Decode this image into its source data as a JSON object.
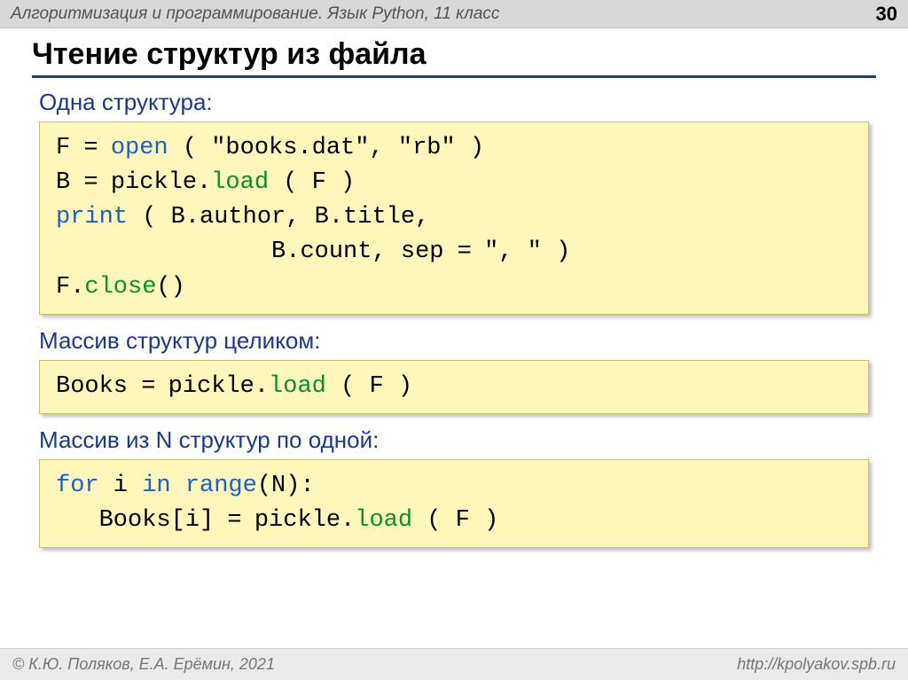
{
  "header": {
    "title": "Алгоритмизация и программирование. Язык Python, 11 класс",
    "page": "30"
  },
  "title": "Чтение структур из файла",
  "section1": {
    "label": "Одна структура:"
  },
  "code1": {
    "l1_a": "F",
    "l1_eq": " = ",
    "l1_open": "open",
    "l1_b": " ( \"books.dat\", \"rb\" )",
    "l2_a": "B",
    "l2_eq": " = ",
    "l2_b": "pickle.",
    "l2_load": "load",
    "l2_c": " ( F )",
    "l3_print": "print",
    "l3_a": " ( B.author, B.title,",
    "l4_a": "               B.count, sep",
    "l4_eq": " = ",
    "l4_b": "\", \" )",
    "l5_a": "F.",
    "l5_close": "close",
    "l5_b": "()"
  },
  "section2": {
    "label": "Массив структур целиком:"
  },
  "code2": {
    "l1_a": "Books",
    "l1_eq": " = ",
    "l1_b": "pickle.",
    "l1_load": "load",
    "l1_c": " ( F )"
  },
  "section3": {
    "label": "Массив из N структур по одной:"
  },
  "code3": {
    "l1_for": "for",
    "l1_a": " i ",
    "l1_in": "in",
    "l1_b": " ",
    "l1_range": "range",
    "l1_c": "(N):",
    "l2_a": "   Books[i]",
    "l2_eq": " = ",
    "l2_b": "pickle.",
    "l2_load": "load",
    "l2_c": " ( F )"
  },
  "footer": {
    "left": "© К.Ю. Поляков, Е.А. Ерёмин, 2021",
    "right": "http://kpolyakov.spb.ru"
  }
}
